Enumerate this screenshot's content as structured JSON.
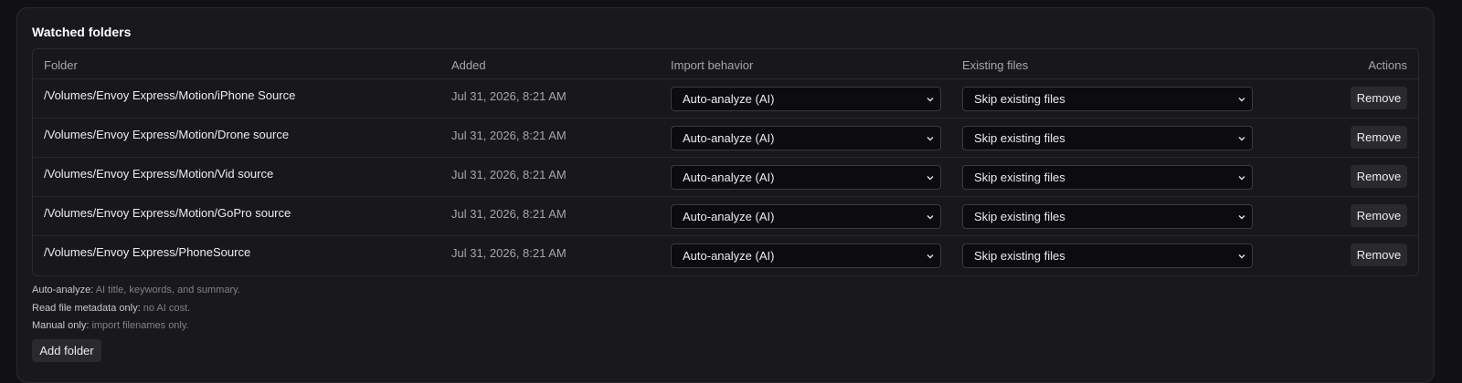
{
  "panel": {
    "title": "Watched folders"
  },
  "table": {
    "headers": {
      "folder": "Folder",
      "added": "Added",
      "import_behavior": "Import behavior",
      "existing_files": "Existing files",
      "actions": "Actions"
    },
    "rows": [
      {
        "folder": "/Volumes/Envoy Express/Motion/iPhone Source",
        "added": "Jul 31, 2026, 8:21 AM",
        "import_behavior": "Auto-analyze (AI)",
        "existing_files": "Skip existing files",
        "action": "Remove"
      },
      {
        "folder": "/Volumes/Envoy Express/Motion/Drone source",
        "added": "Jul 31, 2026, 8:21 AM",
        "import_behavior": "Auto-analyze (AI)",
        "existing_files": "Skip existing files",
        "action": "Remove"
      },
      {
        "folder": "/Volumes/Envoy Express/Motion/Vid source",
        "added": "Jul 31, 2026, 8:21 AM",
        "import_behavior": "Auto-analyze (AI)",
        "existing_files": "Skip existing files",
        "action": "Remove"
      },
      {
        "folder": "/Volumes/Envoy Express/Motion/GoPro source",
        "added": "Jul 31, 2026, 8:21 AM",
        "import_behavior": "Auto-analyze (AI)",
        "existing_files": "Skip existing files",
        "action": "Remove"
      },
      {
        "folder": "/Volumes/Envoy Express/PhoneSource",
        "added": "Jul 31, 2026, 8:21 AM",
        "import_behavior": "Auto-analyze (AI)",
        "existing_files": "Skip existing files",
        "action": "Remove"
      }
    ]
  },
  "notes": [
    {
      "term": "Auto-analyze:",
      "desc": "AI title, keywords, and summary."
    },
    {
      "term": "Read file metadata only:",
      "desc": "no AI cost."
    },
    {
      "term": "Manual only:",
      "desc": "import filenames only."
    }
  ],
  "add_folder_label": "Add folder",
  "icons": {
    "select_chevron": "chevron-down-icon"
  }
}
